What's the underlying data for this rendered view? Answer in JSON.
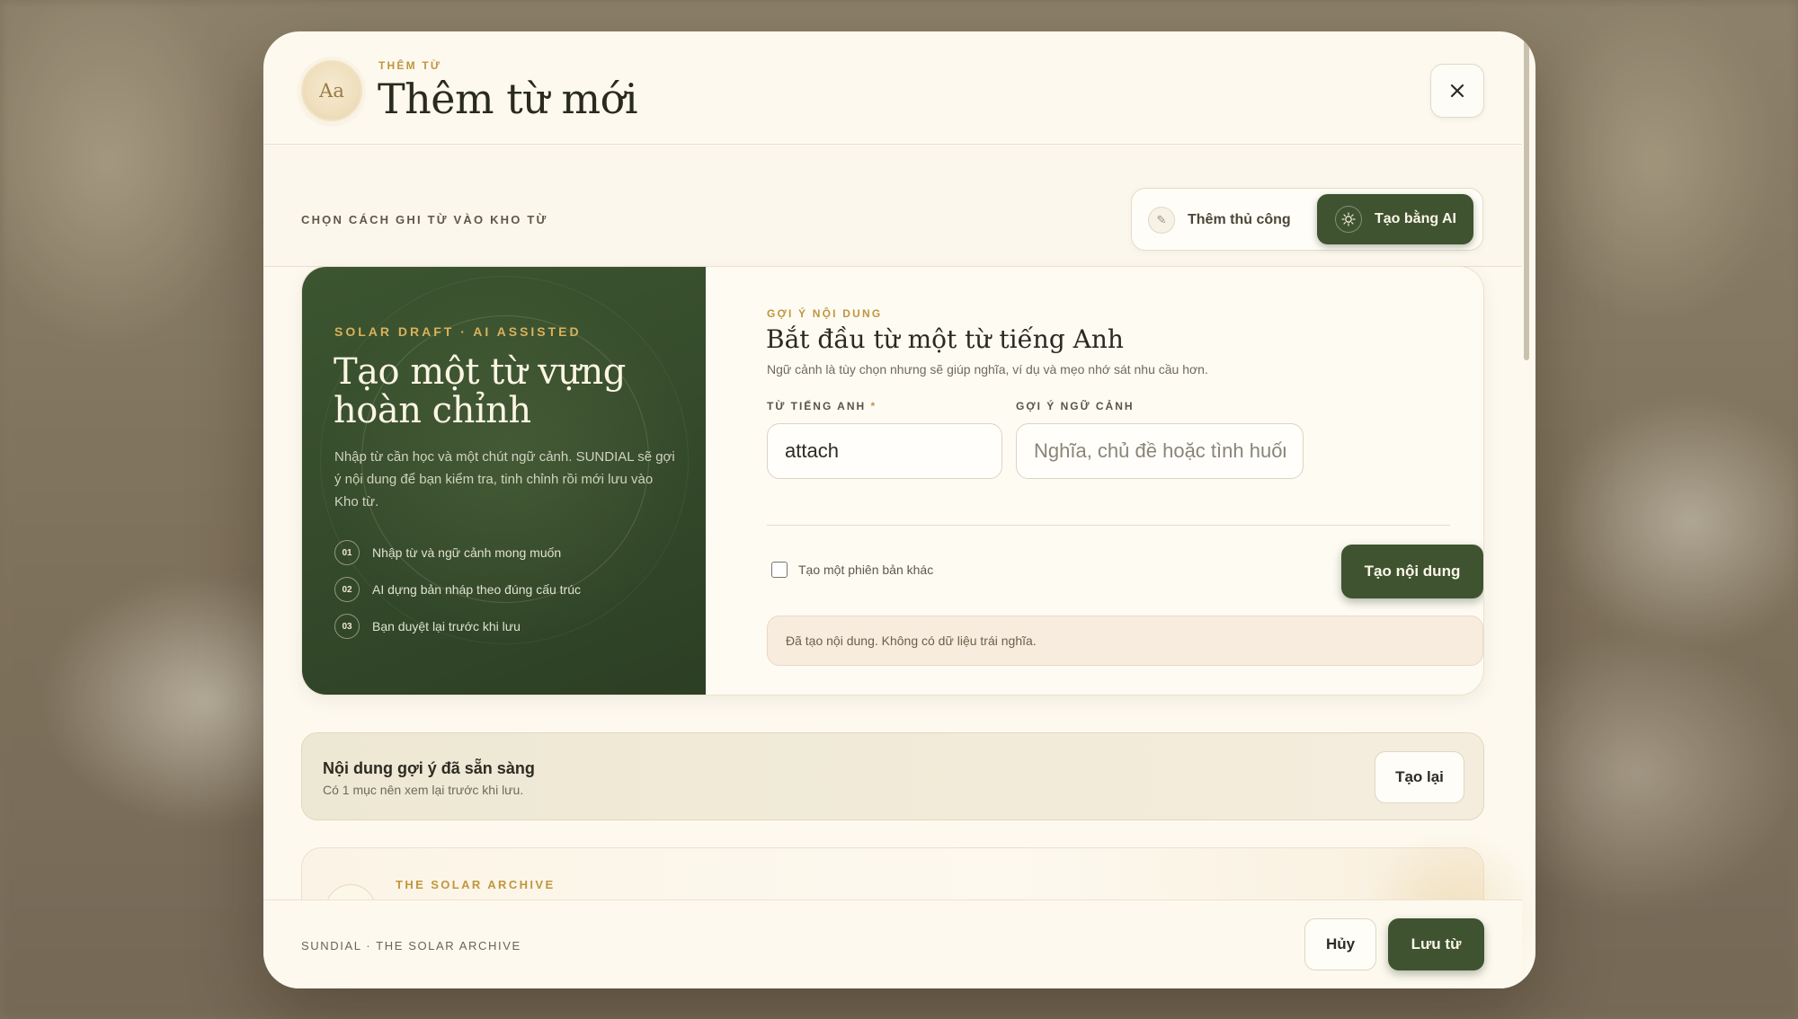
{
  "header": {
    "kicker": "THÊM TỪ",
    "title": "Thêm từ mới",
    "logo_text": "Aa",
    "close_icon": "close-icon"
  },
  "mode": {
    "label": "CHỌN CÁCH GHI TỪ VÀO KHO TỪ",
    "options": [
      {
        "label": "Thêm thủ công",
        "icon": "pencil-icon",
        "selected": false
      },
      {
        "label": "Tạo bằng AI",
        "icon": "sparkle-icon",
        "selected": true
      }
    ]
  },
  "panel": {
    "kicker": "SOLAR DRAFT · AI ASSISTED",
    "title": "Tạo một từ vựng hoàn chỉnh",
    "description": "Nhập từ cần học và một chút ngữ cảnh. SUNDIAL sẽ gợi ý nội dung để bạn kiểm tra, tinh chỉnh rồi mới lưu vào Kho từ.",
    "steps": [
      {
        "num": "01",
        "text": "Nhập từ và ngữ cảnh mong muốn"
      },
      {
        "num": "02",
        "text": "AI dựng bản nháp theo đúng cấu trúc"
      },
      {
        "num": "03",
        "text": "Bạn duyệt lại trước khi lưu"
      }
    ]
  },
  "form": {
    "kicker": "GỢI Ý NỘI DUNG",
    "title": "Bắt đầu từ một từ tiếng Anh",
    "subtitle": "Ngữ cảnh là tùy chọn nhưng sẽ giúp nghĩa, ví dụ và mẹo nhớ sát nhu cầu hơn.",
    "word_label": "TỪ TIẾNG ANH",
    "word_required": "*",
    "word_value": "attach",
    "context_label": "GỢI Ý NGỮ CẢNH",
    "context_placeholder": "Nghĩa, chủ đề hoặc tình huống mong muốn",
    "variant_label": "Tạo một phiên bản khác",
    "generate_label": "Tạo nội dung",
    "notice": "Đã tạo nội dung. Không có dữ liệu trái nghĩa."
  },
  "ready": {
    "title": "Nội dung gợi ý đã sẵn sàng",
    "subtitle": "Có 1 mục nên xem lại trước khi lưu.",
    "redo_label": "Tạo lại"
  },
  "archive": {
    "kicker": "THE SOLAR ARCHIVE"
  },
  "footer": {
    "text": "SUNDIAL · THE SOLAR ARCHIVE",
    "cancel_label": "Hủy",
    "save_label": "Lưu từ"
  },
  "colors": {
    "accent_green": "#3f5331",
    "accent_gold": "#c0963e",
    "modal_bg": "#fdf9ef"
  }
}
